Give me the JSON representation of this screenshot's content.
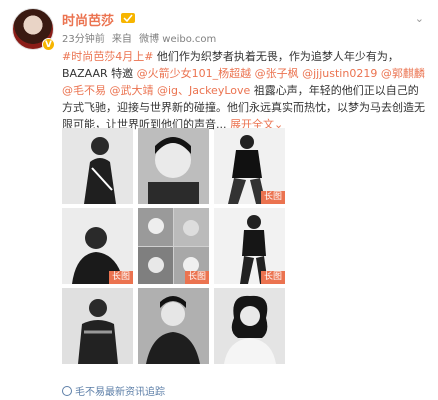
{
  "post": {
    "author": "时尚芭莎",
    "time": "23分钟前",
    "source_prefix": "来自",
    "source": "微博 weibo.com",
    "text": {
      "topic": "#时尚芭莎4月上#",
      "line1": " 他们作为织梦者执着无畏，作为追梦人年少有为，BAZAAR 特邀",
      "mentions": [
        "@火箭少女101_杨超越",
        "@张子枫",
        "@jjjustin0219",
        "@郭麒麟",
        "@毛不易",
        "@武大靖",
        "@ig、JackeyLove"
      ],
      "line2": " 祖露心声，年轻的他们正以自己的方式飞驰，迎接与世界新的碰撞。他们永远真实而热忱，以梦为马去创造无限可能，让世界听到他们的声音",
      "ellipsis": "...",
      "expand": "展开全文",
      "expand_arrow": "⌄"
    },
    "long_image_tag": "长图",
    "footer_text": "毛不易最新资讯追踪"
  },
  "colors": {
    "accent": "#eb7350",
    "link": "#5d7fa8"
  },
  "icons": {
    "verified": "verified-badge-icon",
    "chevron": "chevron-down-icon"
  }
}
